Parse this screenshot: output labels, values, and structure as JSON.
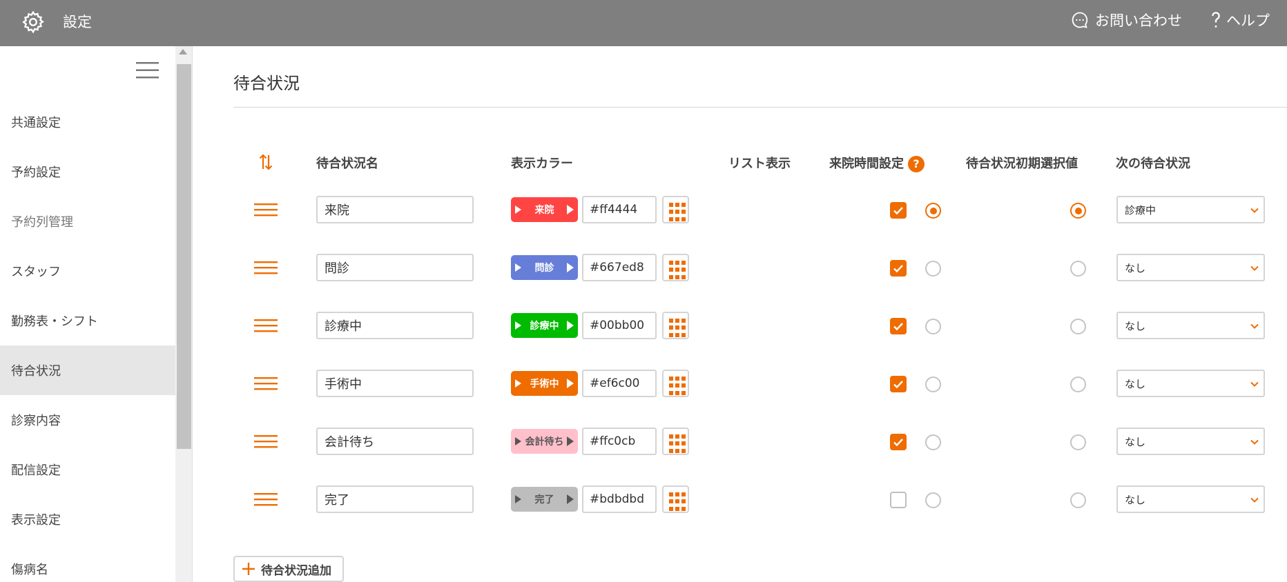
{
  "header": {
    "title": "設定",
    "contact_label": "お問い合わせ",
    "help_label": "ヘルプ",
    "background_color": "#7f7f7f"
  },
  "sidebar": {
    "items": [
      {
        "label": "共通設定",
        "state": "normal"
      },
      {
        "label": "予約設定",
        "state": "normal"
      },
      {
        "label": "予約列管理",
        "state": "muted"
      },
      {
        "label": "スタッフ",
        "state": "normal"
      },
      {
        "label": "勤務表・シフト",
        "state": "normal"
      },
      {
        "label": "待合状況",
        "state": "active"
      },
      {
        "label": "診察内容",
        "state": "normal"
      },
      {
        "label": "配信設定",
        "state": "normal"
      },
      {
        "label": "表示設定",
        "state": "normal"
      },
      {
        "label": "傷病名",
        "state": "normal"
      }
    ]
  },
  "main": {
    "title": "待合状況",
    "columns": {
      "name": "待合状況名",
      "color": "表示カラー",
      "list_display": "リスト表示",
      "visit_time": "来院時間設定",
      "visit_time_help": "?",
      "initial_value": "待合状況初期選択値",
      "next_status": "次の待合状況"
    },
    "rows": [
      {
        "name": "来院",
        "badge": "来院",
        "hex": "#ff4444",
        "color": "#ff4444",
        "text_color": "#ffffff",
        "list": true,
        "visit_time": true,
        "initial": true,
        "next": "診療中"
      },
      {
        "name": "問診",
        "badge": "問診",
        "hex": "#667ed8",
        "color": "#667ed8",
        "text_color": "#ffffff",
        "list": true,
        "visit_time": false,
        "initial": false,
        "next": "なし"
      },
      {
        "name": "診療中",
        "badge": "診療中",
        "hex": "#00bb00",
        "color": "#00bb00",
        "text_color": "#ffffff",
        "list": true,
        "visit_time": false,
        "initial": false,
        "next": "なし"
      },
      {
        "name": "手術中",
        "badge": "手術中",
        "hex": "#ef6c00",
        "color": "#ef6c00",
        "text_color": "#ffffff",
        "list": true,
        "visit_time": false,
        "initial": false,
        "next": "なし"
      },
      {
        "name": "会計待ち",
        "badge": "会計待ち",
        "hex": "#ffc0cb",
        "color": "#ffc0cb",
        "text_color": "#555555",
        "list": true,
        "visit_time": false,
        "initial": false,
        "next": "なし"
      },
      {
        "name": "完了",
        "badge": "完了",
        "hex": "#bdbdbd",
        "color": "#bdbdbd",
        "text_color": "#555555",
        "list": false,
        "visit_time": false,
        "initial": false,
        "next": "なし"
      }
    ],
    "add_button_label": "待合状況追加",
    "accent_color": "#ef6c00"
  }
}
